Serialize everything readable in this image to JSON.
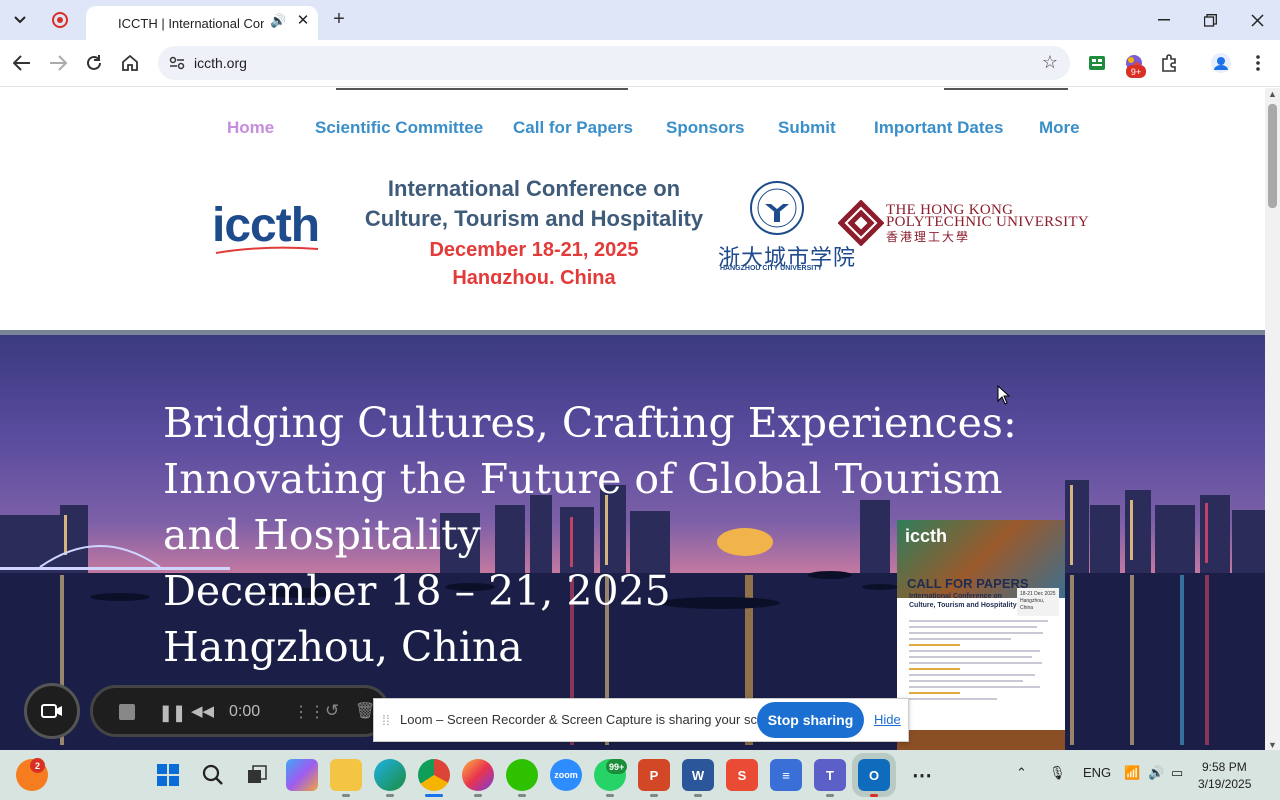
{
  "browser": {
    "tab_title": "ICCTH | International Confe",
    "url": "iccth.org"
  },
  "site": {
    "nav": [
      "Home",
      "Scientific Committee",
      "Call for Papers",
      "Sponsors",
      "Submit",
      "Important Dates",
      "More"
    ],
    "active_nav": "Home",
    "logo_text": "iccth",
    "conf_title_line1": "International Conference on",
    "conf_title_line2": "Culture, Tourism and Hospitality",
    "conf_date": "December 18-21, 2025",
    "conf_place": "Hangzhou, China",
    "hcu_name_cn": "浙大城市学院",
    "hcu_name_en": "HANGZHOU CITY UNIVERSITY",
    "polyu_line1": "THE HONG KONG",
    "polyu_line2": "POLYTECHNIC UNIVERSITY",
    "polyu_cn": "香港理工大學"
  },
  "hero": {
    "lines": [
      "Bridging Cultures, Crafting Experiences:",
      "Innovating the Future of Global Tourism",
      "and Hospitality",
      "December 18 – 21, 2025",
      "Hangzhou, China"
    ]
  },
  "poster": {
    "logo": "iccth",
    "headline": "CALL FOR PAPERS",
    "subtitle": "International Conference on Culture, Tourism and Hospitality",
    "date": "18-21 Dec 2025 Hangzhou, China"
  },
  "loom": {
    "time": "0:00",
    "share_message": "Loom – Screen Recorder & Screen Capture is sharing your screen.",
    "stop_label": "Stop sharing",
    "hide_label": "Hide"
  },
  "taskbar": {
    "start_badge": "2",
    "whatsapp_badge": "99+",
    "zoom_label": "zoom",
    "ext_badge": "9+",
    "language": "ENG",
    "time": "9:58 PM",
    "date": "3/19/2025"
  },
  "colors": {
    "nav_link": "#3a8fc9",
    "nav_active": "#c78cdc",
    "conf_red": "#e33a3a",
    "loom_blue": "#1a6fd0"
  }
}
